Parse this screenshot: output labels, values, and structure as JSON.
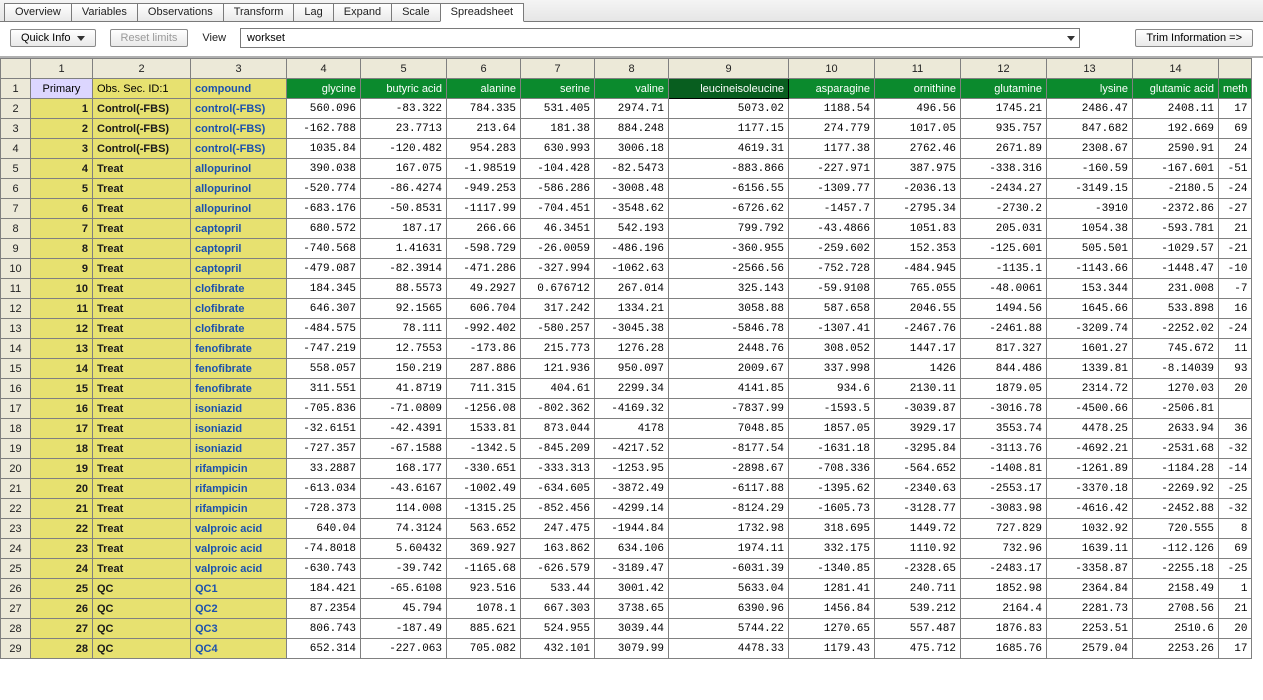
{
  "tabs": [
    "Overview",
    "Variables",
    "Observations",
    "Transform",
    "Lag",
    "Expand",
    "Scale",
    "Spreadsheet"
  ],
  "active_tab": 7,
  "toolbar": {
    "quick_info": "Quick Info",
    "reset_limits": "Reset limits",
    "view_label": "View",
    "view_value": "workset",
    "trim": "Trim Information =>"
  },
  "colnums": [
    "",
    "1",
    "2",
    "3",
    "4",
    "5",
    "6",
    "7",
    "8",
    "9",
    "10",
    "11",
    "12",
    "13",
    "14",
    ""
  ],
  "headers": {
    "rownum": "1",
    "primary": "Primary",
    "obs": "Obs. Sec. ID:1",
    "compound": "compound",
    "vars": [
      "glycine",
      "butyric acid",
      "alanine",
      "serine",
      "valine",
      "leucineisoleucine",
      "asparagine",
      "ornithine",
      "glutamine",
      "lysine",
      "glutamic acid",
      "meth"
    ],
    "selected_var_index": 5
  },
  "rows": [
    {
      "n": 2,
      "p": "1",
      "o": "Control(-FBS)",
      "c": "control(-FBS)",
      "v": [
        "560.096",
        "-83.322",
        "784.335",
        "531.405",
        "2974.71",
        "5073.02",
        "1188.54",
        "496.56",
        "1745.21",
        "2486.47",
        "2408.11",
        "17"
      ]
    },
    {
      "n": 3,
      "p": "2",
      "o": "Control(-FBS)",
      "c": "control(-FBS)",
      "v": [
        "-162.788",
        "23.7713",
        "213.64",
        "181.38",
        "884.248",
        "1177.15",
        "274.779",
        "1017.05",
        "935.757",
        "847.682",
        "192.669",
        "69"
      ]
    },
    {
      "n": 4,
      "p": "3",
      "o": "Control(-FBS)",
      "c": "control(-FBS)",
      "v": [
        "1035.84",
        "-120.482",
        "954.283",
        "630.993",
        "3006.18",
        "4619.31",
        "1177.38",
        "2762.46",
        "2671.89",
        "2308.67",
        "2590.91",
        "24"
      ]
    },
    {
      "n": 5,
      "p": "4",
      "o": "Treat",
      "c": "allopurinol",
      "v": [
        "390.038",
        "167.075",
        "-1.98519",
        "-104.428",
        "-82.5473",
        "-883.866",
        "-227.971",
        "387.975",
        "-338.316",
        "-160.59",
        "-167.601",
        "-51"
      ]
    },
    {
      "n": 6,
      "p": "5",
      "o": "Treat",
      "c": "allopurinol",
      "v": [
        "-520.774",
        "-86.4274",
        "-949.253",
        "-586.286",
        "-3008.48",
        "-6156.55",
        "-1309.77",
        "-2036.13",
        "-2434.27",
        "-3149.15",
        "-2180.5",
        "-24"
      ]
    },
    {
      "n": 7,
      "p": "6",
      "o": "Treat",
      "c": "allopurinol",
      "v": [
        "-683.176",
        "-50.8531",
        "-1117.99",
        "-704.451",
        "-3548.62",
        "-6726.62",
        "-1457.7",
        "-2795.34",
        "-2730.2",
        "-3910",
        "-2372.86",
        "-27"
      ]
    },
    {
      "n": 8,
      "p": "7",
      "o": "Treat",
      "c": "captopril",
      "v": [
        "680.572",
        "187.17",
        "266.66",
        "46.3451",
        "542.193",
        "799.792",
        "-43.4866",
        "1051.83",
        "205.031",
        "1054.38",
        "-593.781",
        "21"
      ]
    },
    {
      "n": 9,
      "p": "8",
      "o": "Treat",
      "c": "captopril",
      "v": [
        "-740.568",
        "1.41631",
        "-598.729",
        "-26.0059",
        "-486.196",
        "-360.955",
        "-259.602",
        "152.353",
        "-125.601",
        "505.501",
        "-1029.57",
        "-21"
      ]
    },
    {
      "n": 10,
      "p": "9",
      "o": "Treat",
      "c": "captopril",
      "v": [
        "-479.087",
        "-82.3914",
        "-471.286",
        "-327.994",
        "-1062.63",
        "-2566.56",
        "-752.728",
        "-484.945",
        "-1135.1",
        "-1143.66",
        "-1448.47",
        "-10"
      ]
    },
    {
      "n": 11,
      "p": "10",
      "o": "Treat",
      "c": "clofibrate",
      "v": [
        "184.345",
        "88.5573",
        "49.2927",
        "0.676712",
        "267.014",
        "325.143",
        "-59.9108",
        "765.055",
        "-48.0061",
        "153.344",
        "231.008",
        "-7"
      ]
    },
    {
      "n": 12,
      "p": "11",
      "o": "Treat",
      "c": "clofibrate",
      "v": [
        "646.307",
        "92.1565",
        "606.704",
        "317.242",
        "1334.21",
        "3058.88",
        "587.658",
        "2046.55",
        "1494.56",
        "1645.66",
        "533.898",
        "16"
      ]
    },
    {
      "n": 13,
      "p": "12",
      "o": "Treat",
      "c": "clofibrate",
      "v": [
        "-484.575",
        "78.111",
        "-992.402",
        "-580.257",
        "-3045.38",
        "-5846.78",
        "-1307.41",
        "-2467.76",
        "-2461.88",
        "-3209.74",
        "-2252.02",
        "-24"
      ]
    },
    {
      "n": 14,
      "p": "13",
      "o": "Treat",
      "c": "fenofibrate",
      "v": [
        "-747.219",
        "12.7553",
        "-173.86",
        "215.773",
        "1276.28",
        "2448.76",
        "308.052",
        "1447.17",
        "817.327",
        "1601.27",
        "745.672",
        "11"
      ]
    },
    {
      "n": 15,
      "p": "14",
      "o": "Treat",
      "c": "fenofibrate",
      "v": [
        "558.057",
        "150.219",
        "287.886",
        "121.936",
        "950.097",
        "2009.67",
        "337.998",
        "1426",
        "844.486",
        "1339.81",
        "-8.14039",
        "93"
      ]
    },
    {
      "n": 16,
      "p": "15",
      "o": "Treat",
      "c": "fenofibrate",
      "v": [
        "311.551",
        "41.8719",
        "711.315",
        "404.61",
        "2299.34",
        "4141.85",
        "934.6",
        "2130.11",
        "1879.05",
        "2314.72",
        "1270.03",
        "20"
      ]
    },
    {
      "n": 17,
      "p": "16",
      "o": "Treat",
      "c": "isoniazid",
      "v": [
        "-705.836",
        "-71.0809",
        "-1256.08",
        "-802.362",
        "-4169.32",
        "-7837.99",
        "-1593.5",
        "-3039.87",
        "-3016.78",
        "-4500.66",
        "-2506.81",
        ""
      ]
    },
    {
      "n": 18,
      "p": "17",
      "o": "Treat",
      "c": "isoniazid",
      "v": [
        "-32.6151",
        "-42.4391",
        "1533.81",
        "873.044",
        "4178",
        "7048.85",
        "1857.05",
        "3929.17",
        "3553.74",
        "4478.25",
        "2633.94",
        "36"
      ]
    },
    {
      "n": 19,
      "p": "18",
      "o": "Treat",
      "c": "isoniazid",
      "v": [
        "-727.357",
        "-67.1588",
        "-1342.5",
        "-845.209",
        "-4217.52",
        "-8177.54",
        "-1631.18",
        "-3295.84",
        "-3113.76",
        "-4692.21",
        "-2531.68",
        "-32"
      ]
    },
    {
      "n": 20,
      "p": "19",
      "o": "Treat",
      "c": "rifampicin",
      "v": [
        "33.2887",
        "168.177",
        "-330.651",
        "-333.313",
        "-1253.95",
        "-2898.67",
        "-708.336",
        "-564.652",
        "-1408.81",
        "-1261.89",
        "-1184.28",
        "-14"
      ]
    },
    {
      "n": 21,
      "p": "20",
      "o": "Treat",
      "c": "rifampicin",
      "v": [
        "-613.034",
        "-43.6167",
        "-1002.49",
        "-634.605",
        "-3872.49",
        "-6117.88",
        "-1395.62",
        "-2340.63",
        "-2553.17",
        "-3370.18",
        "-2269.92",
        "-25"
      ]
    },
    {
      "n": 22,
      "p": "21",
      "o": "Treat",
      "c": "rifampicin",
      "v": [
        "-728.373",
        "114.008",
        "-1315.25",
        "-852.456",
        "-4299.14",
        "-8124.29",
        "-1605.73",
        "-3128.77",
        "-3083.98",
        "-4616.42",
        "-2452.88",
        "-32"
      ]
    },
    {
      "n": 23,
      "p": "22",
      "o": "Treat",
      "c": "valproic acid",
      "v": [
        "640.04",
        "74.3124",
        "563.652",
        "247.475",
        "-1944.84",
        "1732.98",
        "318.695",
        "1449.72",
        "727.829",
        "1032.92",
        "720.555",
        "8"
      ]
    },
    {
      "n": 24,
      "p": "23",
      "o": "Treat",
      "c": "valproic acid",
      "v": [
        "-74.8018",
        "5.60432",
        "369.927",
        "163.862",
        "634.106",
        "1974.11",
        "332.175",
        "1110.92",
        "732.96",
        "1639.11",
        "-112.126",
        "69"
      ]
    },
    {
      "n": 25,
      "p": "24",
      "o": "Treat",
      "c": "valproic acid",
      "v": [
        "-630.743",
        "-39.742",
        "-1165.68",
        "-626.579",
        "-3189.47",
        "-6031.39",
        "-1340.85",
        "-2328.65",
        "-2483.17",
        "-3358.87",
        "-2255.18",
        "-25"
      ]
    },
    {
      "n": 26,
      "p": "25",
      "o": "QC",
      "c": "QC1",
      "v": [
        "184.421",
        "-65.6108",
        "923.516",
        "533.44",
        "3001.42",
        "5633.04",
        "1281.41",
        "240.711",
        "1852.98",
        "2364.84",
        "2158.49",
        "1"
      ]
    },
    {
      "n": 27,
      "p": "26",
      "o": "QC",
      "c": "QC2",
      "v": [
        "87.2354",
        "45.794",
        "1078.1",
        "667.303",
        "3738.65",
        "6390.96",
        "1456.84",
        "539.212",
        "2164.4",
        "2281.73",
        "2708.56",
        "21"
      ]
    },
    {
      "n": 28,
      "p": "27",
      "o": "QC",
      "c": "QC3",
      "v": [
        "806.743",
        "-187.49",
        "885.621",
        "524.955",
        "3039.44",
        "5744.22",
        "1270.65",
        "557.487",
        "1876.83",
        "2253.51",
        "2510.6",
        "20"
      ]
    },
    {
      "n": 29,
      "p": "28",
      "o": "QC",
      "c": "QC4",
      "v": [
        "652.314",
        "-227.063",
        "705.082",
        "432.101",
        "3079.99",
        "4478.33",
        "1179.43",
        "475.712",
        "1685.76",
        "2579.04",
        "2253.26",
        "17"
      ]
    }
  ]
}
